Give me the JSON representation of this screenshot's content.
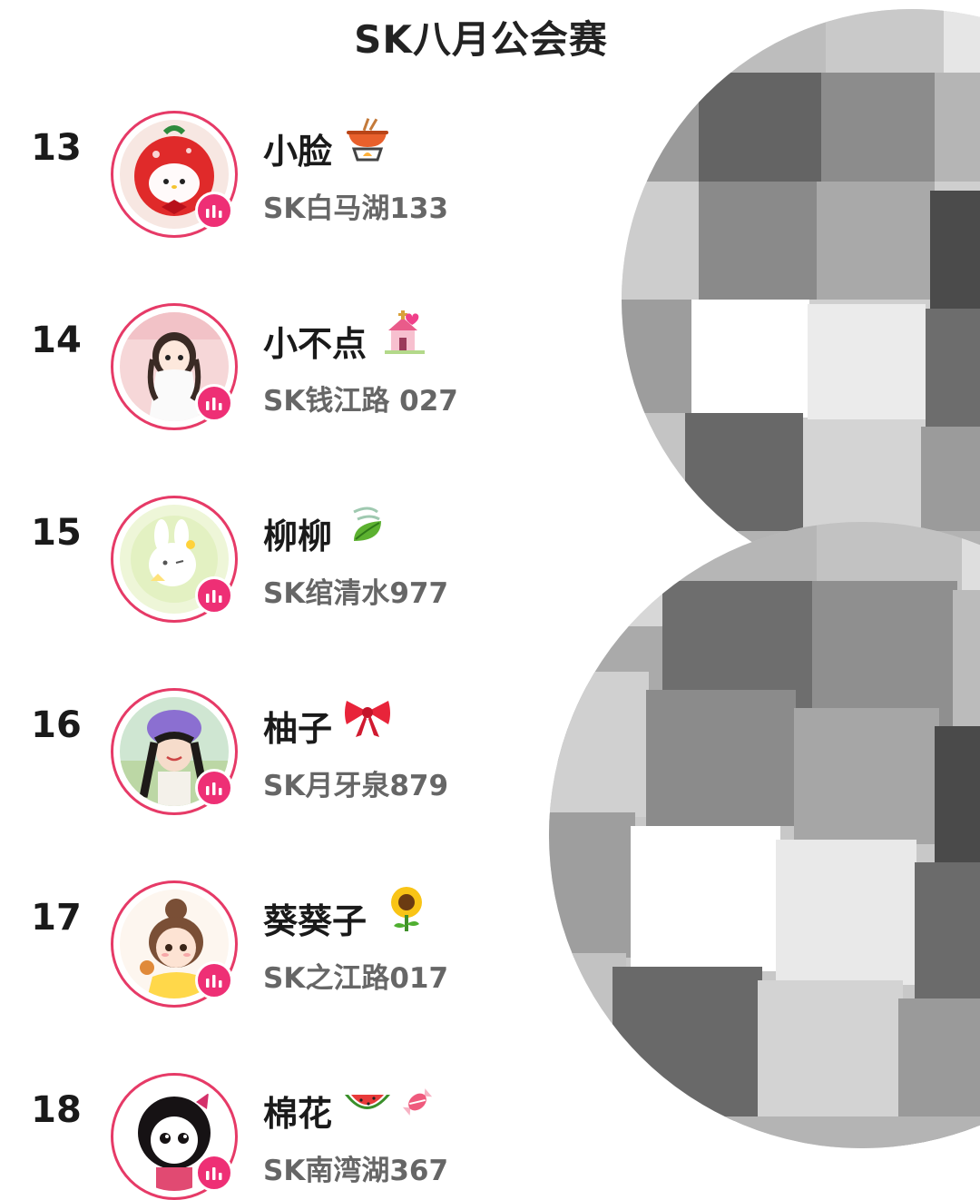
{
  "header": {
    "title": "SK八月公会赛"
  },
  "ranking": [
    {
      "rank": "13",
      "name": "小脸",
      "id": "SK白马湖133",
      "name_emoji": "hotpot-emoji"
    },
    {
      "rank": "14",
      "name": "小不点",
      "id": "SK钱江路 027",
      "name_emoji": "wedding-chapel-emoji"
    },
    {
      "rank": "15",
      "name": "柳柳",
      "id": "SK绾清水977",
      "name_emoji": "leaf-wind-emoji"
    },
    {
      "rank": "16",
      "name": "柚子",
      "id": "SK月牙泉879",
      "name_emoji": "ribbon-bow-emoji"
    },
    {
      "rank": "17",
      "name": "葵葵子",
      "id": "SK之江路017",
      "name_emoji": "sunflower-emoji"
    },
    {
      "rank": "18",
      "name": "棉花",
      "id": "SK南湾湖367",
      "name_emoji": "watermelon-candy-emoji"
    }
  ],
  "colors": {
    "avatar_ring": "#e63a67",
    "live_badge": "#ee2f75",
    "subtext": "#666666"
  }
}
